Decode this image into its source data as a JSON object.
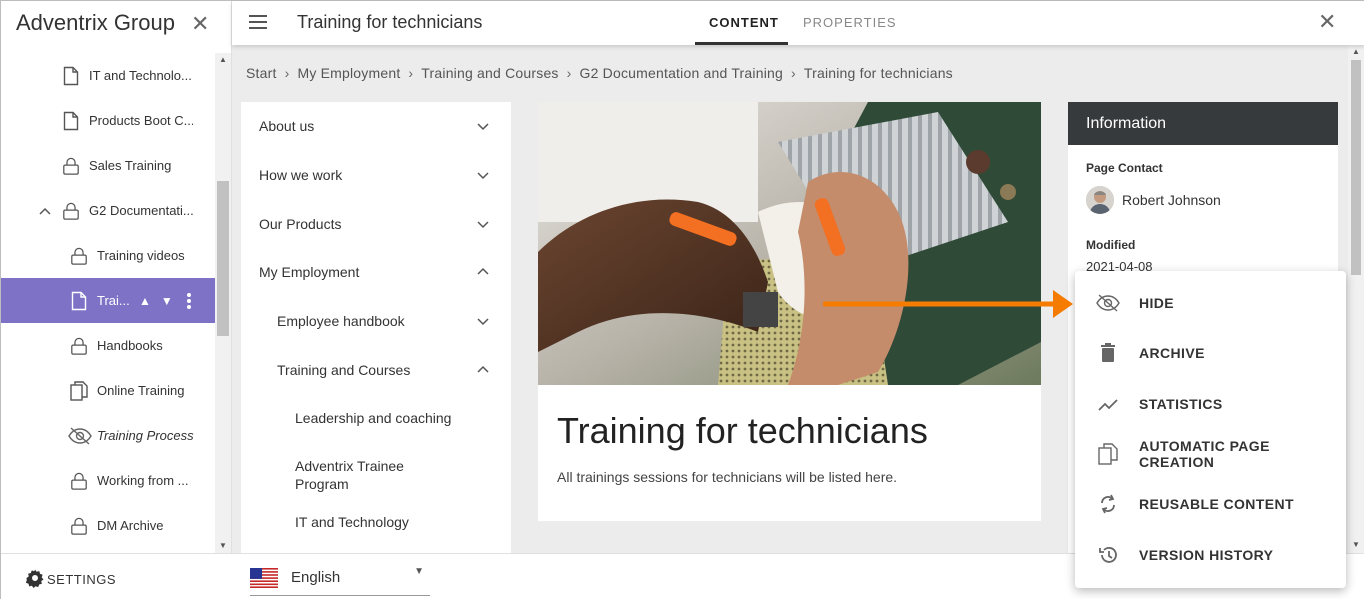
{
  "app": {
    "title": "Adventrix Group"
  },
  "tree": {
    "items": [
      {
        "label": "IT and Technolo...",
        "icon": "page-icon"
      },
      {
        "label": "Products Boot C...",
        "icon": "page-icon"
      },
      {
        "label": "Sales Training",
        "icon": "lock-icon"
      },
      {
        "label": "G2 Documentati...",
        "icon": "lock-icon",
        "expanded": true
      },
      {
        "label": "Training videos",
        "icon": "lock-icon"
      },
      {
        "label": "Trai...",
        "icon": "page-icon",
        "selected": true
      },
      {
        "label": "Handbooks",
        "icon": "lock-icon"
      },
      {
        "label": "Online Training",
        "icon": "copy-icon"
      },
      {
        "label": "Training Process",
        "icon": "eye-off-icon",
        "hidden": true
      },
      {
        "label": "Working from ...",
        "icon": "lock-icon"
      },
      {
        "label": "DM Archive",
        "icon": "lock-icon"
      }
    ]
  },
  "header": {
    "page_title": "Training for technicians",
    "tabs": {
      "content": "CONTENT",
      "properties": "PROPERTIES"
    },
    "active_tab": "content"
  },
  "breadcrumb": [
    "Start",
    "My Employment",
    "Training and Courses",
    "G2 Documentation and Training",
    "Training for technicians"
  ],
  "site_nav": {
    "items": [
      {
        "label": "About us",
        "chevron": "down",
        "level": 0
      },
      {
        "label": "How we work",
        "chevron": "down",
        "level": 0
      },
      {
        "label": "Our Products",
        "chevron": "down",
        "level": 0
      },
      {
        "label": "My Employment",
        "chevron": "up",
        "level": 0
      },
      {
        "label": "Employee handbook",
        "chevron": "down",
        "level": 1
      },
      {
        "label": "Training and Courses",
        "chevron": "up",
        "level": 1
      },
      {
        "label": "Leadership and coaching",
        "chevron": "",
        "level": 2
      },
      {
        "label": "Adventrix Trainee Program",
        "chevron": "",
        "level": 2
      },
      {
        "label": "IT and Technology",
        "chevron": "",
        "level": 2
      }
    ]
  },
  "page": {
    "heading": "Training for technicians",
    "body": "All trainings sessions for technicians will be listed here."
  },
  "info": {
    "title": "Information",
    "page_contact_label": "Page Contact",
    "contact_name": "Robert Johnson",
    "modified_label": "Modified",
    "modified_value": "2021-04-08"
  },
  "context_menu": {
    "items": [
      {
        "label": "HIDE",
        "icon": "eye-off-icon"
      },
      {
        "label": "ARCHIVE",
        "icon": "trash-icon"
      },
      {
        "label": "STATISTICS",
        "icon": "trend-icon"
      },
      {
        "label": "AUTOMATIC PAGE CREATION",
        "icon": "copy-icon"
      },
      {
        "label": "REUSABLE CONTENT",
        "icon": "sync-icon"
      },
      {
        "label": "VERSION HISTORY",
        "icon": "history-icon"
      }
    ]
  },
  "footer": {
    "settings_label": "SETTINGS",
    "language": "English"
  },
  "colors": {
    "selected_row": "#7e72c7",
    "info_header": "#373a3c",
    "arrow": "#f57c00",
    "content_bg": "#ececec"
  }
}
